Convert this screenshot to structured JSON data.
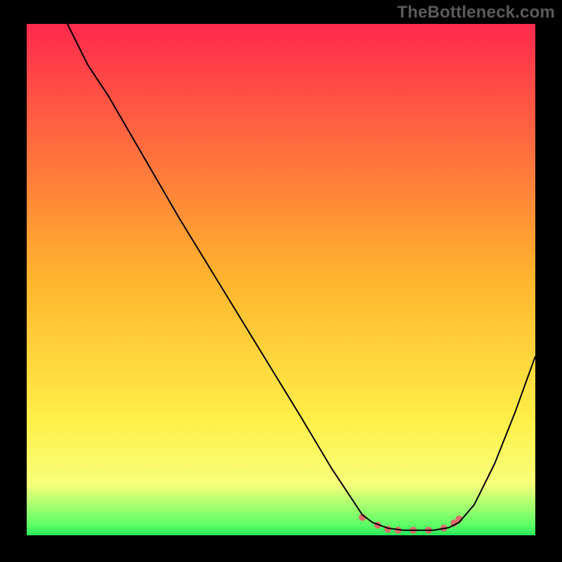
{
  "watermark": "TheBottleneck.com",
  "chart_data": {
    "type": "line",
    "title": "",
    "xlabel": "",
    "ylabel": "",
    "xlim": [
      0,
      100
    ],
    "ylim": [
      0,
      100
    ],
    "grid": false,
    "legend": false,
    "background_gradient_stops": [
      {
        "offset": 0.0,
        "color": "#ff2a4e"
      },
      {
        "offset": 0.5,
        "color": "#ffb52d"
      },
      {
        "offset": 0.78,
        "color": "#fff04a"
      },
      {
        "offset": 0.9,
        "color": "#f7ff7a"
      },
      {
        "offset": 0.98,
        "color": "#5cff66"
      },
      {
        "offset": 1.0,
        "color": "#28e65a"
      }
    ],
    "highlight_band_y": {
      "from": 97,
      "to": 99,
      "color": "#dc6c6c"
    },
    "series": [
      {
        "name": "curve",
        "stroke": "#000000",
        "stroke_width": 2,
        "x": [
          8,
          12,
          16,
          23,
          30,
          38,
          46,
          54,
          60,
          64,
          66,
          68,
          71,
          74,
          77,
          80,
          83,
          85,
          88,
          92,
          96,
          100
        ],
        "y": [
          0,
          8,
          14,
          26,
          38,
          51,
          64,
          77,
          87,
          93,
          96,
          97.5,
          98.6,
          99,
          99,
          99,
          98.5,
          97.5,
          94,
          86,
          76,
          65
        ]
      }
    ],
    "marker_points": {
      "comment": "salmon/pink dots along the trough",
      "color": "#dc6c6c",
      "radius": 5,
      "points": [
        {
          "x": 66,
          "y": 96.5
        },
        {
          "x": 69,
          "y": 98.0
        },
        {
          "x": 71,
          "y": 98.8
        },
        {
          "x": 73,
          "y": 99.0
        },
        {
          "x": 76,
          "y": 99.0
        },
        {
          "x": 79,
          "y": 99.0
        },
        {
          "x": 82,
          "y": 98.6
        },
        {
          "x": 84,
          "y": 97.6
        },
        {
          "x": 85,
          "y": 96.8
        }
      ]
    }
  }
}
